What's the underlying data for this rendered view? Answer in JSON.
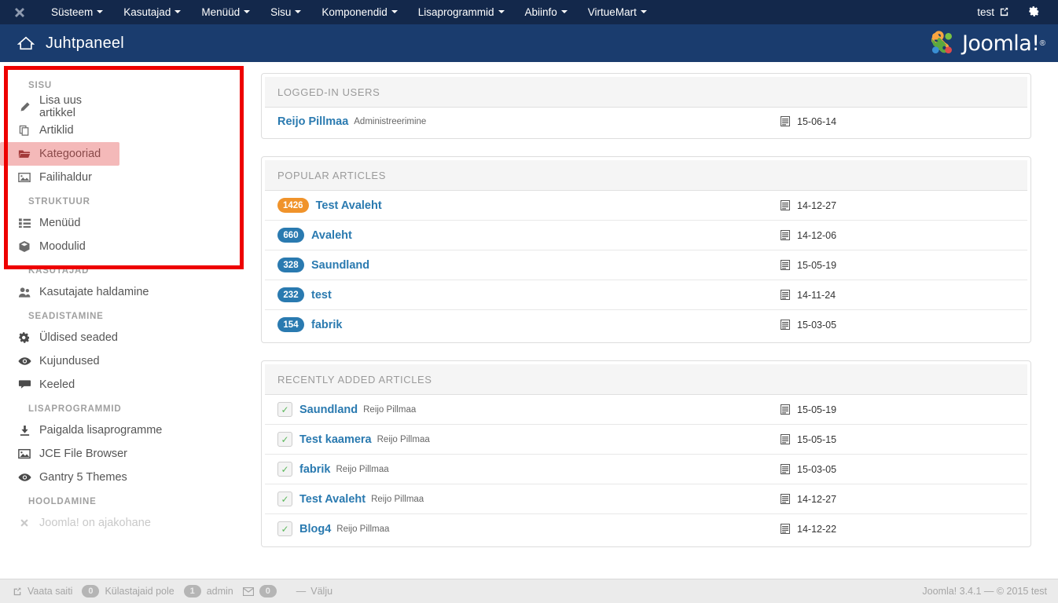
{
  "topbar": {
    "brand_icon": "joomla-mark-icon",
    "menu": [
      {
        "label": "Süsteem",
        "caret": true
      },
      {
        "label": "Kasutajad",
        "caret": true
      },
      {
        "label": "Menüüd",
        "caret": true
      },
      {
        "label": "Sisu",
        "caret": true
      },
      {
        "label": "Komponendid",
        "caret": true
      },
      {
        "label": "Lisaprogrammid",
        "caret": true
      },
      {
        "label": "Abiinfo",
        "caret": true
      },
      {
        "label": "VirtueMart",
        "caret": true
      }
    ],
    "user_label": "test",
    "external_icon": "external-link-icon",
    "gear_icon": "gear-icon"
  },
  "subheader": {
    "home_icon": "home-icon",
    "title": "Juhtpaneel",
    "logo_text": "Joomla!",
    "logo_reg": "®"
  },
  "sidebar": {
    "groups": [
      {
        "title": "SISU",
        "items": [
          {
            "label": "Lisa uus artikkel",
            "icon": "pencil-icon",
            "active": false
          },
          {
            "label": "Artiklid",
            "icon": "copy-icon",
            "active": false
          },
          {
            "label": "Kategooriad",
            "icon": "folder-open-icon",
            "active": true
          },
          {
            "label": "Failihaldur",
            "icon": "image-icon",
            "active": false
          }
        ]
      },
      {
        "title": "STRUKTUUR",
        "items": [
          {
            "label": "Menüüd",
            "icon": "list-icon",
            "active": false
          },
          {
            "label": "Moodulid",
            "icon": "cube-icon",
            "active": false
          }
        ]
      },
      {
        "title": "KASUTAJAD",
        "items": [
          {
            "label": "Kasutajate haldamine",
            "icon": "users-icon",
            "active": false
          }
        ]
      },
      {
        "title": "SEADISTAMINE",
        "items": [
          {
            "label": "Üldised seaded",
            "icon": "gear-icon",
            "active": false
          },
          {
            "label": "Kujundused",
            "icon": "eye-icon",
            "active": false
          },
          {
            "label": "Keeled",
            "icon": "comment-icon",
            "active": false
          }
        ]
      },
      {
        "title": "LISAPROGRAMMID",
        "items": [
          {
            "label": "Paigalda lisaprogramme",
            "icon": "download-icon",
            "active": false
          },
          {
            "label": "JCE File Browser",
            "icon": "image-icon",
            "active": false
          },
          {
            "label": "Gantry 5 Themes",
            "icon": "eye-icon",
            "active": false
          }
        ]
      },
      {
        "title": "HOOLDAMINE",
        "items": [
          {
            "label": "Joomla! on ajakohane",
            "icon": "joomla-mark-icon",
            "active": false
          }
        ]
      }
    ],
    "highlight_color": "#f4b9b9",
    "annotation_box_color": "#ee0000"
  },
  "panels": {
    "logged_in_users": {
      "title": "LOGGED-IN USERS",
      "rows": [
        {
          "name": "Reijo Pillmaa",
          "meta": "Administreerimine",
          "date": "15-06-14",
          "date_icon": "calendar-icon"
        }
      ]
    },
    "popular_articles": {
      "title": "POPULAR ARTICLES",
      "rows": [
        {
          "count": "1426",
          "badge_color": "orange",
          "title": "Test Avaleht",
          "date": "14-12-27",
          "date_icon": "calendar-icon"
        },
        {
          "count": "660",
          "badge_color": "blue",
          "title": "Avaleht",
          "date": "14-12-06",
          "date_icon": "calendar-icon"
        },
        {
          "count": "328",
          "badge_color": "blue",
          "title": "Saundland",
          "date": "15-05-19",
          "date_icon": "calendar-icon"
        },
        {
          "count": "232",
          "badge_color": "blue",
          "title": "test",
          "date": "14-11-24",
          "date_icon": "calendar-icon"
        },
        {
          "count": "154",
          "badge_color": "blue",
          "title": "fabrik",
          "date": "15-03-05",
          "date_icon": "calendar-icon"
        }
      ]
    },
    "recently_added": {
      "title": "RECENTLY ADDED ARTICLES",
      "rows": [
        {
          "check_icon": "check-icon",
          "title": "Saundland",
          "author": "Reijo Pillmaa",
          "date": "15-05-19",
          "date_icon": "calendar-icon"
        },
        {
          "check_icon": "check-icon",
          "title": "Test kaamera",
          "author": "Reijo Pillmaa",
          "date": "15-05-15",
          "date_icon": "calendar-icon"
        },
        {
          "check_icon": "check-icon",
          "title": "fabrik",
          "author": "Reijo Pillmaa",
          "date": "15-03-05",
          "date_icon": "calendar-icon"
        },
        {
          "check_icon": "check-icon",
          "title": "Test Avaleht",
          "author": "Reijo Pillmaa",
          "date": "14-12-27",
          "date_icon": "calendar-icon"
        },
        {
          "check_icon": "check-icon",
          "title": "Blog4",
          "author": "Reijo Pillmaa",
          "date": "14-12-22",
          "date_icon": "calendar-icon"
        }
      ]
    }
  },
  "footer": {
    "view_site_icon": "external-link-icon",
    "view_site_label": "Vaata saiti",
    "visitors_count": "0",
    "visitors_label": "Külastajaid pole",
    "admin_count": "1",
    "admin_label": "admin",
    "mail_icon": "envelope-icon",
    "mail_count": "0",
    "dash": "—",
    "logout_label": "Välju",
    "copyright": "Joomla! 3.4.1  —  © 2015 test"
  },
  "colors": {
    "topbar": "#13284b",
    "subheader": "#1a3c6e",
    "link": "#2a7ab0",
    "badge_orange": "#f0932b",
    "badge_blue": "#2a7ab0",
    "annotation": "#ee0000",
    "highlight": "#f4b9b9"
  }
}
